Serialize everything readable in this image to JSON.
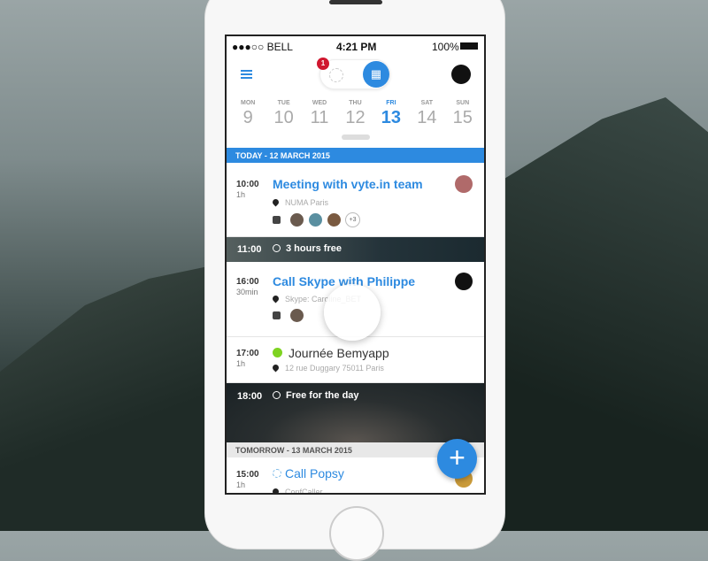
{
  "status_bar": {
    "carrier": "●●●○○ BELL",
    "time": "4:21 PM",
    "battery": "100%"
  },
  "header": {
    "notification_count": "1",
    "accent": "#2d8ae0"
  },
  "week": [
    {
      "name": "MON",
      "num": "9"
    },
    {
      "name": "TUE",
      "num": "10"
    },
    {
      "name": "WED",
      "num": "11"
    },
    {
      "name": "THU",
      "num": "12"
    },
    {
      "name": "FRI",
      "num": "13",
      "selected": true
    },
    {
      "name": "SAT",
      "num": "14"
    },
    {
      "name": "SUN",
      "num": "15"
    }
  ],
  "sections": {
    "today": "TODAY - 12 MARCH 2015",
    "tomorrow": "TOMORROW - 13 MARCH 2015"
  },
  "events": [
    {
      "time": "10:00",
      "duration": "1h",
      "title": "Meeting with vyte.in team",
      "location": "NUMA Paris",
      "extra_participants": "+3"
    },
    {
      "time": "16:00",
      "duration": "30min",
      "title": "Call Skype with Philippe",
      "location": "Skype: Caroline_BET"
    },
    {
      "time": "17:00",
      "duration": "1h",
      "title": "Journée Bemyapp",
      "location": "12 rue Duggary 75011 Paris",
      "status_color": "#7ed321"
    },
    {
      "time": "15:00",
      "duration": "1h",
      "title": "Call Popsy",
      "location": "ConfCaller"
    }
  ],
  "free_slots": [
    {
      "time": "11:00",
      "label": "3 hours free"
    },
    {
      "time": "18:00",
      "label": "Free for the day"
    }
  ],
  "fab": {
    "label": "+"
  }
}
